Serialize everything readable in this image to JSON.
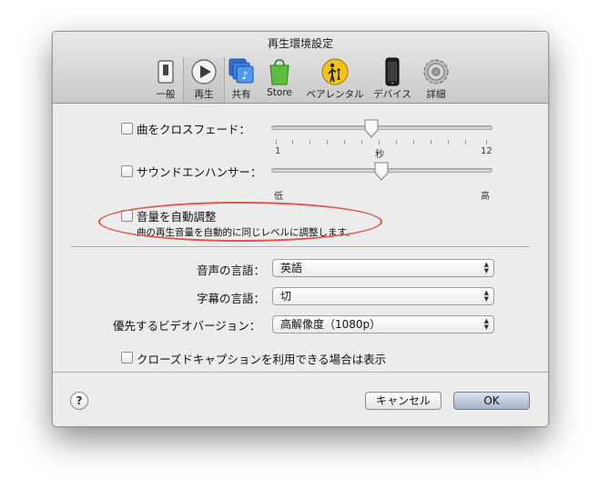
{
  "window": {
    "title": "再生環境設定"
  },
  "toolbar": {
    "items": [
      {
        "label": "一般",
        "icon": "switch-icon"
      },
      {
        "label": "再生",
        "icon": "play-icon"
      },
      {
        "label": "共有",
        "icon": "music-share-icon"
      },
      {
        "label": "Store",
        "icon": "shopping-bag-icon"
      },
      {
        "label": "ペアレンタル",
        "icon": "parental-control-icon"
      },
      {
        "label": "デバイス",
        "icon": "phone-icon"
      },
      {
        "label": "詳細",
        "icon": "gear-icon"
      }
    ],
    "selected": "再生"
  },
  "crossfade": {
    "label": "曲をクロスフェード：",
    "checked": false,
    "min_label": "1",
    "mid_label": "秒",
    "max_label": "12",
    "value_seconds": 6
  },
  "sound_enhancer": {
    "label": "サウンドエンハンサー：",
    "checked": false,
    "min_label": "低",
    "max_label": "高",
    "value_fraction": 0.5
  },
  "sound_check": {
    "label": "音量を自動調整",
    "checked": false,
    "description": "曲の再生音量を自動的に同じレベルに調整します。"
  },
  "audio_language": {
    "label": "音声の言語：",
    "value": "英語"
  },
  "subtitle_language": {
    "label": "字幕の言語：",
    "value": "切"
  },
  "video_version": {
    "label": "優先するビデオバージョン：",
    "value": "高解像度（1080p）"
  },
  "closed_captions": {
    "label": "クローズドキャプションを利用できる場合は表示",
    "checked": false
  },
  "buttons": {
    "help": "?",
    "cancel": "キャンセル",
    "ok": "OK"
  },
  "colors": {
    "highlight_oval": "#e0574b",
    "default_button": "#a7b4c4"
  }
}
